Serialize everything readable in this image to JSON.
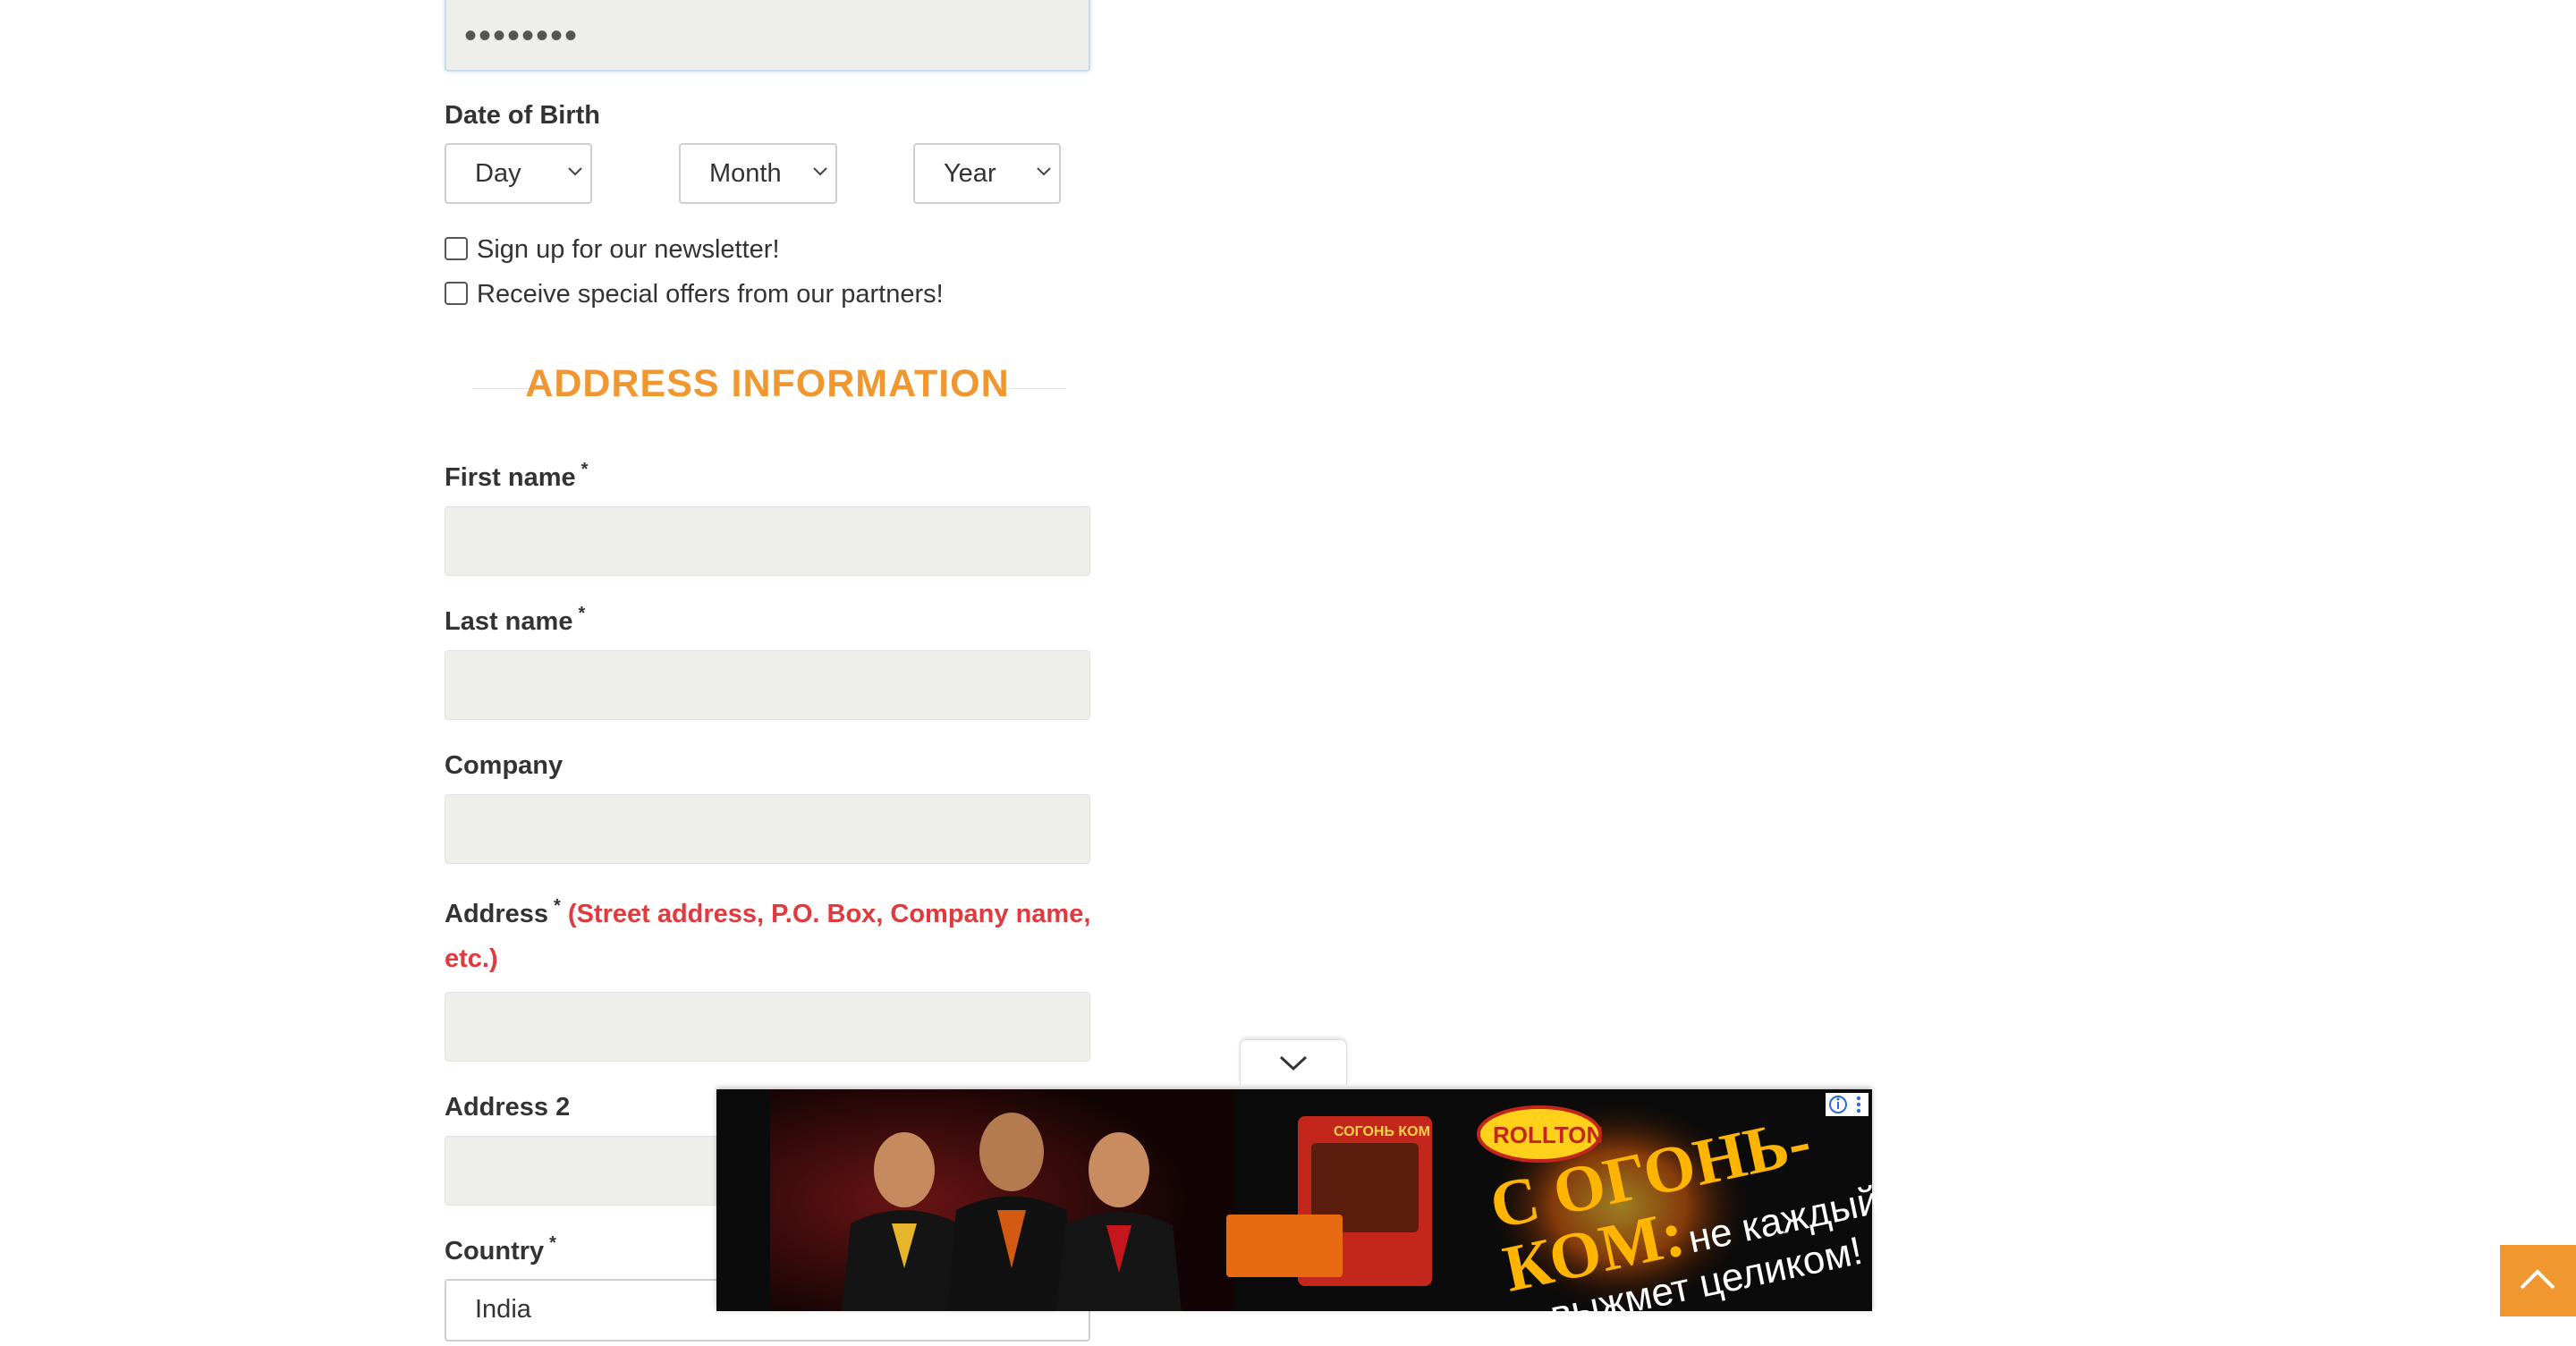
{
  "password": {
    "value": "••••••••"
  },
  "dob": {
    "label": "Date of Birth",
    "day": "Day",
    "month": "Month",
    "year": "Year"
  },
  "checkboxes": {
    "newsletter": "Sign up for our newsletter!",
    "partners": "Receive special offers from our partners!"
  },
  "section": {
    "title": "ADDRESS INFORMATION"
  },
  "fields": {
    "first_name": "First name",
    "last_name": "Last name",
    "company": "Company",
    "address": "Address",
    "address_hint": "(Street address, P.O. Box, Company name,",
    "address_hint_2": "etc.)",
    "address2": "Address 2",
    "country": "Country",
    "country_value": "India",
    "required_mark": "*"
  },
  "ad": {
    "brand": "ROLLTON",
    "headline_1": "С ОГОНЬ-",
    "headline_2": "КОМ:",
    "tagline_1": "не каждый",
    "tagline_2": "выжмет целиком!",
    "product_text": "СОГОНЬ КОМ"
  },
  "colors": {
    "accent": "#f0982f",
    "error": "#e0393e",
    "input_bg": "#eeefeb"
  }
}
